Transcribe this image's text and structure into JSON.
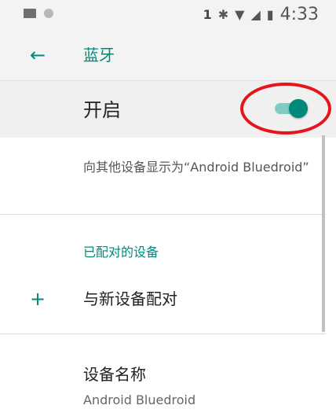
{
  "status_bar": {
    "image_icon": "image-icon",
    "dot_icon": "circle-icon",
    "sim_indicator": "1",
    "bluetooth_icon": "bluetooth-icon",
    "wifi_icon": "wifi-icon",
    "signal_icon": "signal-icon",
    "battery_icon": "battery-icon",
    "time": "4:33"
  },
  "toolbar": {
    "title": "蓝牙",
    "back_icon": "back-arrow-icon"
  },
  "master_switch": {
    "label": "开启",
    "state": "on"
  },
  "summary": "向其他设备显示为“Android Bluedroid”",
  "category": "已配对的设备",
  "pair_new": {
    "label": "与新设备配对",
    "icon": "plus-icon"
  },
  "device_name": {
    "title": "设备名称",
    "value": "Android Bluedroid"
  },
  "colors": {
    "accent": "#00897b",
    "highlight": "#e8141c"
  }
}
